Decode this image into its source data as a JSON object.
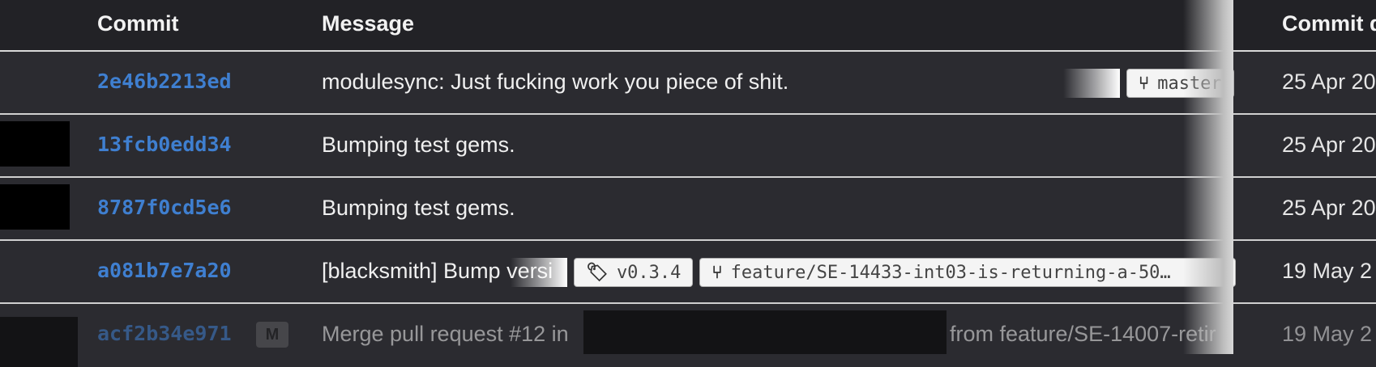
{
  "header": {
    "commit": "Commit",
    "message": "Message",
    "commit_date": "Commit d"
  },
  "rows": [
    {
      "hash": "2e46b2213ed",
      "message": "modulesync: Just fucking work you piece of shit.",
      "date": "25 Apr 20",
      "refs": [
        {
          "type": "branch-icon",
          "label": "master"
        }
      ]
    },
    {
      "hash": "13fcb0edd34",
      "message": "Bumping test gems.",
      "date": "25 Apr 20"
    },
    {
      "hash": "8787f0cd5e6",
      "message": "Bumping test gems.",
      "date": "25 Apr 20"
    },
    {
      "hash": "a081b7e7a20",
      "message": "[blacksmith] Bump versi",
      "date": "19 May 2",
      "refs": [
        {
          "type": "tag-icon",
          "label": "v0.3.4"
        },
        {
          "type": "branch-icon",
          "label": "feature/SE-14433-int03-is-returning-a-50…"
        }
      ]
    },
    {
      "hash": "acf2b34e971",
      "merge_badge": "M",
      "message_prefix": "Merge pull request #12 in",
      "message_suffix": "from feature/SE-14007-retir",
      "date": "19 May 2"
    }
  ]
}
